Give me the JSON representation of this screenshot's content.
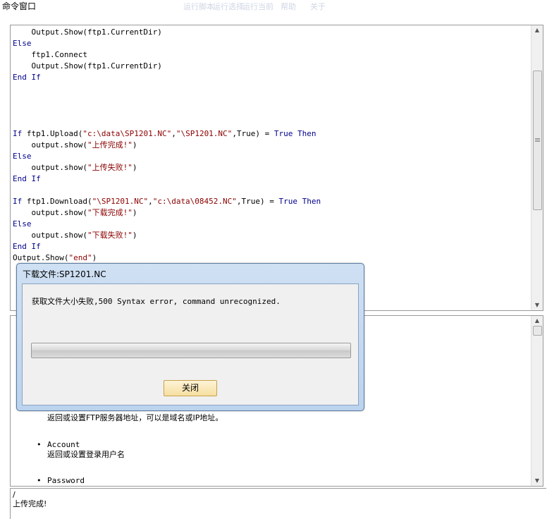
{
  "window": {
    "title": "命令窗口",
    "faint_menu": [
      "运行脚本",
      "运行选择",
      "运行当前",
      "帮助",
      "关于"
    ]
  },
  "editor": {
    "lines": [
      [
        {
          "t": "    Output.Show(ftp1.CurrentDir)",
          "c": "n"
        }
      ],
      [
        {
          "t": "Else",
          "c": "kw"
        }
      ],
      [
        {
          "t": "    ftp1.Connect",
          "c": "n"
        }
      ],
      [
        {
          "t": "    Output.Show(ftp1.CurrentDir)",
          "c": "n"
        }
      ],
      [
        {
          "t": "End If",
          "c": "kw"
        }
      ],
      [
        {
          "t": "",
          "c": "n"
        }
      ],
      [
        {
          "t": "",
          "c": "n"
        }
      ],
      [
        {
          "t": "",
          "c": "n"
        }
      ],
      [
        {
          "t": "",
          "c": "n"
        }
      ],
      [
        {
          "t": "If ",
          "c": "kw"
        },
        {
          "t": "ftp1.Upload(",
          "c": "n"
        },
        {
          "t": "\"c:\\data\\SP1201.NC\"",
          "c": "str"
        },
        {
          "t": ",",
          "c": "n"
        },
        {
          "t": "\"\\SP1201.NC\"",
          "c": "str"
        },
        {
          "t": ",True) = ",
          "c": "n"
        },
        {
          "t": "True Then",
          "c": "kw"
        }
      ],
      [
        {
          "t": "    output.show(",
          "c": "n"
        },
        {
          "t": "\"上传完成!\"",
          "c": "str"
        },
        {
          "t": ")",
          "c": "n"
        }
      ],
      [
        {
          "t": "Else",
          "c": "kw"
        }
      ],
      [
        {
          "t": "    output.show(",
          "c": "n"
        },
        {
          "t": "\"上传失败!\"",
          "c": "str"
        },
        {
          "t": ")",
          "c": "n"
        }
      ],
      [
        {
          "t": "End If",
          "c": "kw"
        }
      ],
      [
        {
          "t": "",
          "c": "n"
        }
      ],
      [
        {
          "t": "If ",
          "c": "kw"
        },
        {
          "t": "ftp1.Download(",
          "c": "n"
        },
        {
          "t": "\"\\SP1201.NC\"",
          "c": "str"
        },
        {
          "t": ",",
          "c": "n"
        },
        {
          "t": "\"c:\\data\\08452.NC\"",
          "c": "str"
        },
        {
          "t": ",True) = ",
          "c": "n"
        },
        {
          "t": "True Then",
          "c": "kw"
        }
      ],
      [
        {
          "t": "    output.show(",
          "c": "n"
        },
        {
          "t": "\"下载完成!\"",
          "c": "str"
        },
        {
          "t": ")",
          "c": "n"
        }
      ],
      [
        {
          "t": "Else",
          "c": "kw"
        }
      ],
      [
        {
          "t": "    output.show(",
          "c": "n"
        },
        {
          "t": "\"下载失败!\"",
          "c": "str"
        },
        {
          "t": ")",
          "c": "n"
        }
      ],
      [
        {
          "t": "End If",
          "c": "kw"
        }
      ],
      [
        {
          "t": "Output.Show(",
          "c": "n"
        },
        {
          "t": "\"end\"",
          "c": "str"
        },
        {
          "t": ")",
          "c": "n"
        }
      ]
    ],
    "colors": {
      "kw": "#00008b",
      "str": "#8b0000",
      "n": "#000000"
    }
  },
  "help": {
    "host_desc": "返回或设置FTP服务器地址，可以是域名或IP地址。",
    "account_name": "Account",
    "account_desc": "返回或设置登录用户名",
    "password_name": "Password"
  },
  "output": {
    "line1": "/",
    "line2": "上传完成!"
  },
  "dialog": {
    "title": "下载文件:SP1201.NC",
    "message": "获取文件大小失败,500 Syntax error, command unrecognized.",
    "progress_fraction": 0,
    "close_label": "关闭"
  }
}
